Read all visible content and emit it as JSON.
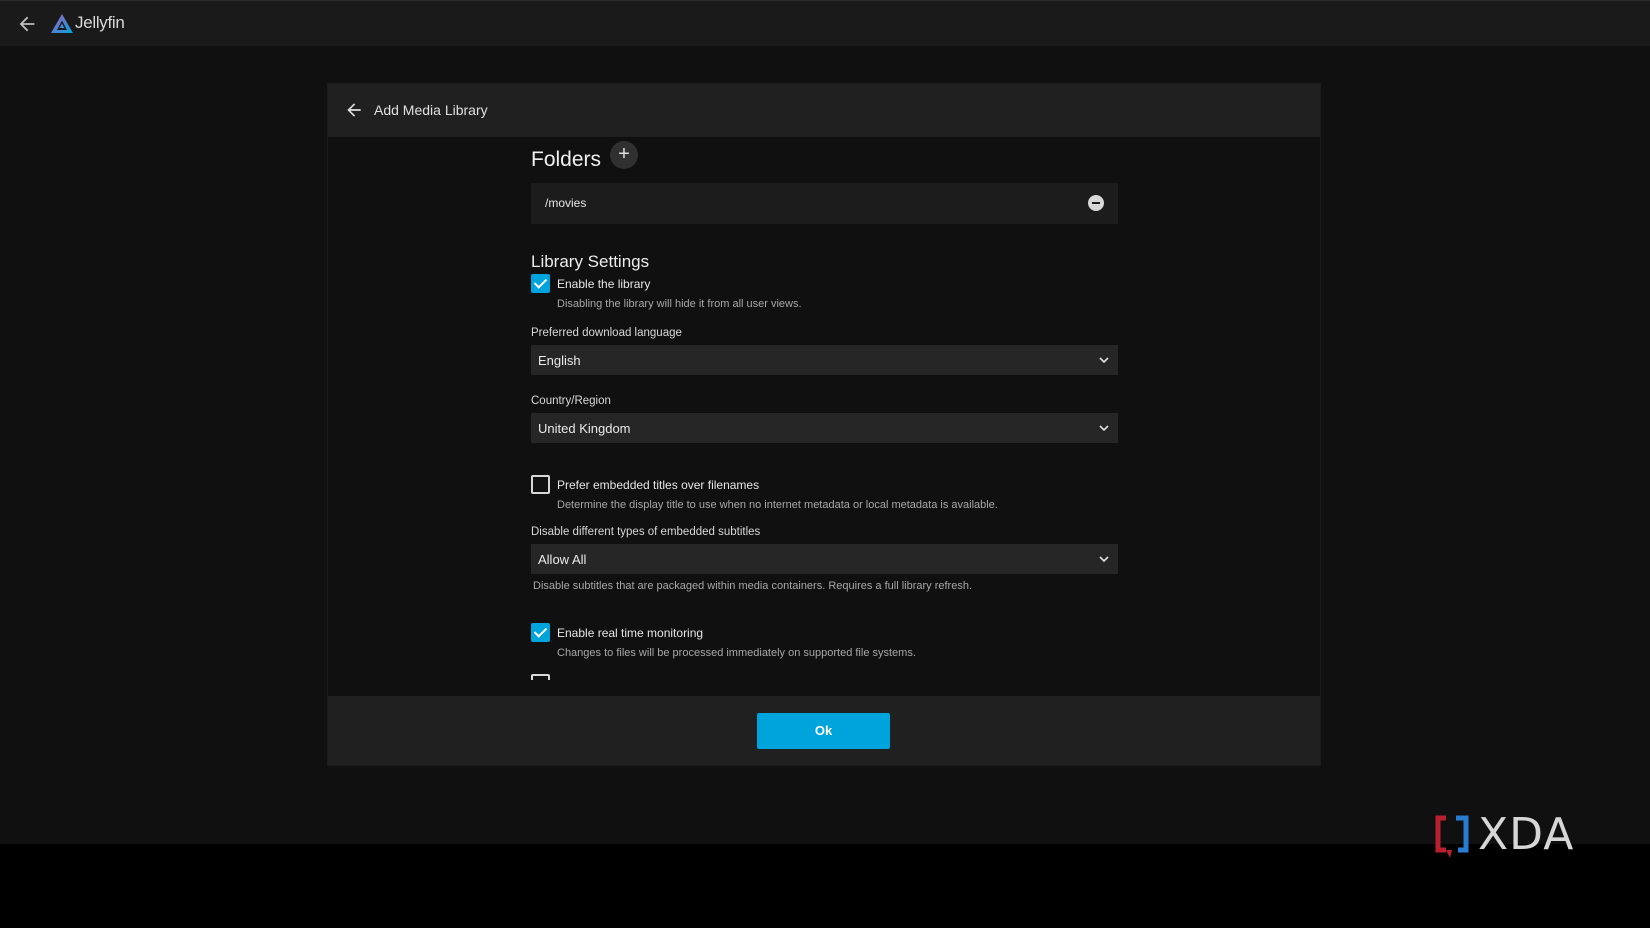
{
  "app": {
    "brand": "Jellyfin"
  },
  "dialog": {
    "title": "Add Media Library",
    "folders_title": "Folders",
    "add_folder_label": "+",
    "folders": [
      "/movies"
    ],
    "section_title": "Library Settings",
    "enable_library": {
      "label": "Enable the library",
      "description": "Disabling the library will hide it from all user views.",
      "checked": true
    },
    "download_language": {
      "label": "Preferred download language",
      "value": "English"
    },
    "country_region": {
      "label": "Country/Region",
      "value": "United Kingdom"
    },
    "prefer_embedded_titles": {
      "label": "Prefer embedded titles over filenames",
      "description": "Determine the display title to use when no internet metadata or local metadata is available.",
      "checked": false
    },
    "embedded_subtitles": {
      "label": "Disable different types of embedded subtitles",
      "value": "Allow All",
      "help": "Disable subtitles that are packaged within media containers. Requires a full library refresh."
    },
    "realtime_monitoring": {
      "label": "Enable real time monitoring",
      "description": "Changes to files will be processed immediately on supported file systems.",
      "checked": true
    },
    "ok_label": "Ok"
  },
  "watermark": {
    "text": "XDA"
  },
  "colors": {
    "accent": "#00a4dc",
    "background": "#101010",
    "panel": "#202020"
  },
  "icons": [
    "back-arrow-icon",
    "jellyfin-logo-icon",
    "plus-icon",
    "minus-circle-icon",
    "chevron-down-icon",
    "checkmark-icon"
  ]
}
